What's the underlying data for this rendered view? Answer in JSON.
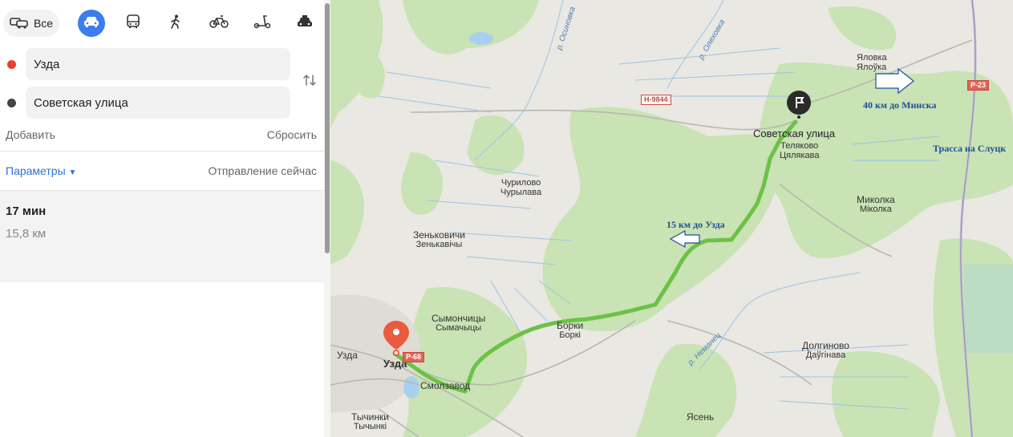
{
  "transport_modes": [
    {
      "name": "all",
      "label": "Все",
      "icon": "car-bus-icon"
    },
    {
      "name": "car",
      "icon": "car-icon",
      "active": true
    },
    {
      "name": "bus",
      "icon": "bus-icon"
    },
    {
      "name": "walk",
      "icon": "pedestrian-icon"
    },
    {
      "name": "bike",
      "icon": "bicycle-icon"
    },
    {
      "name": "scooter",
      "icon": "scooter-icon"
    },
    {
      "name": "taxi",
      "icon": "taxi-icon"
    }
  ],
  "route": {
    "from": "Узда",
    "to": "Советская улица",
    "from_color": "#e8402c",
    "to_color": "#444444"
  },
  "actions": {
    "add": "Добавить",
    "reset": "Сбросить",
    "params": "Параметры",
    "departure": "Отправление сейчас"
  },
  "result": {
    "time": "17 мин",
    "distance": "15,8 км"
  },
  "map": {
    "labels": {
      "destination": "Советская улица",
      "telyakovo_ru": "Теляково",
      "telyakovo_by": "Цялякава",
      "yalovka_ru": "Яловка",
      "yalovka_by": "Ялоўка",
      "churilovo_ru": "Чурилово",
      "churilovo_by": "Чурылава",
      "zenkovichi_ru": "Зеньковичи",
      "zenkovichi_by": "Зенькавічы",
      "symonchitsy_ru": "Сымончицы",
      "symonchitsy_by": "Сымачыцы",
      "borki_ru": "Борки",
      "borki_by": "Боркі",
      "uzda_small": "Узда",
      "uzda_big": "Узда",
      "smolzavod": "Смолзавод",
      "tychinki_ru": "Тычинки",
      "tychinki_by": "Тычынкі",
      "mikolka_ru": "Миколка",
      "mikolka_by": "Міколка",
      "dolginovo_ru": "Долгиново",
      "dolginovo_by": "Даўгінава",
      "yasen": "Ясень"
    },
    "rivers": {
      "osinovka": "р. Осиновка",
      "olekhovka": "р. Олеховка",
      "nemanets": "р. Неманец"
    },
    "road_shields": {
      "n9844": "Н-9844",
      "r23": "Р-23",
      "r68": "Р-68"
    },
    "annotations": {
      "minsk": "40 км до Минска",
      "slutsk": "Трасса на Слуцк",
      "uzda": "15 км до Узда"
    },
    "colors": {
      "route": "#6cc246",
      "forest": "#c9e3b4",
      "start_pin": "#ea5a3f",
      "end_pin": "#2b2b2b",
      "annotation": "#1f4e9a"
    }
  }
}
